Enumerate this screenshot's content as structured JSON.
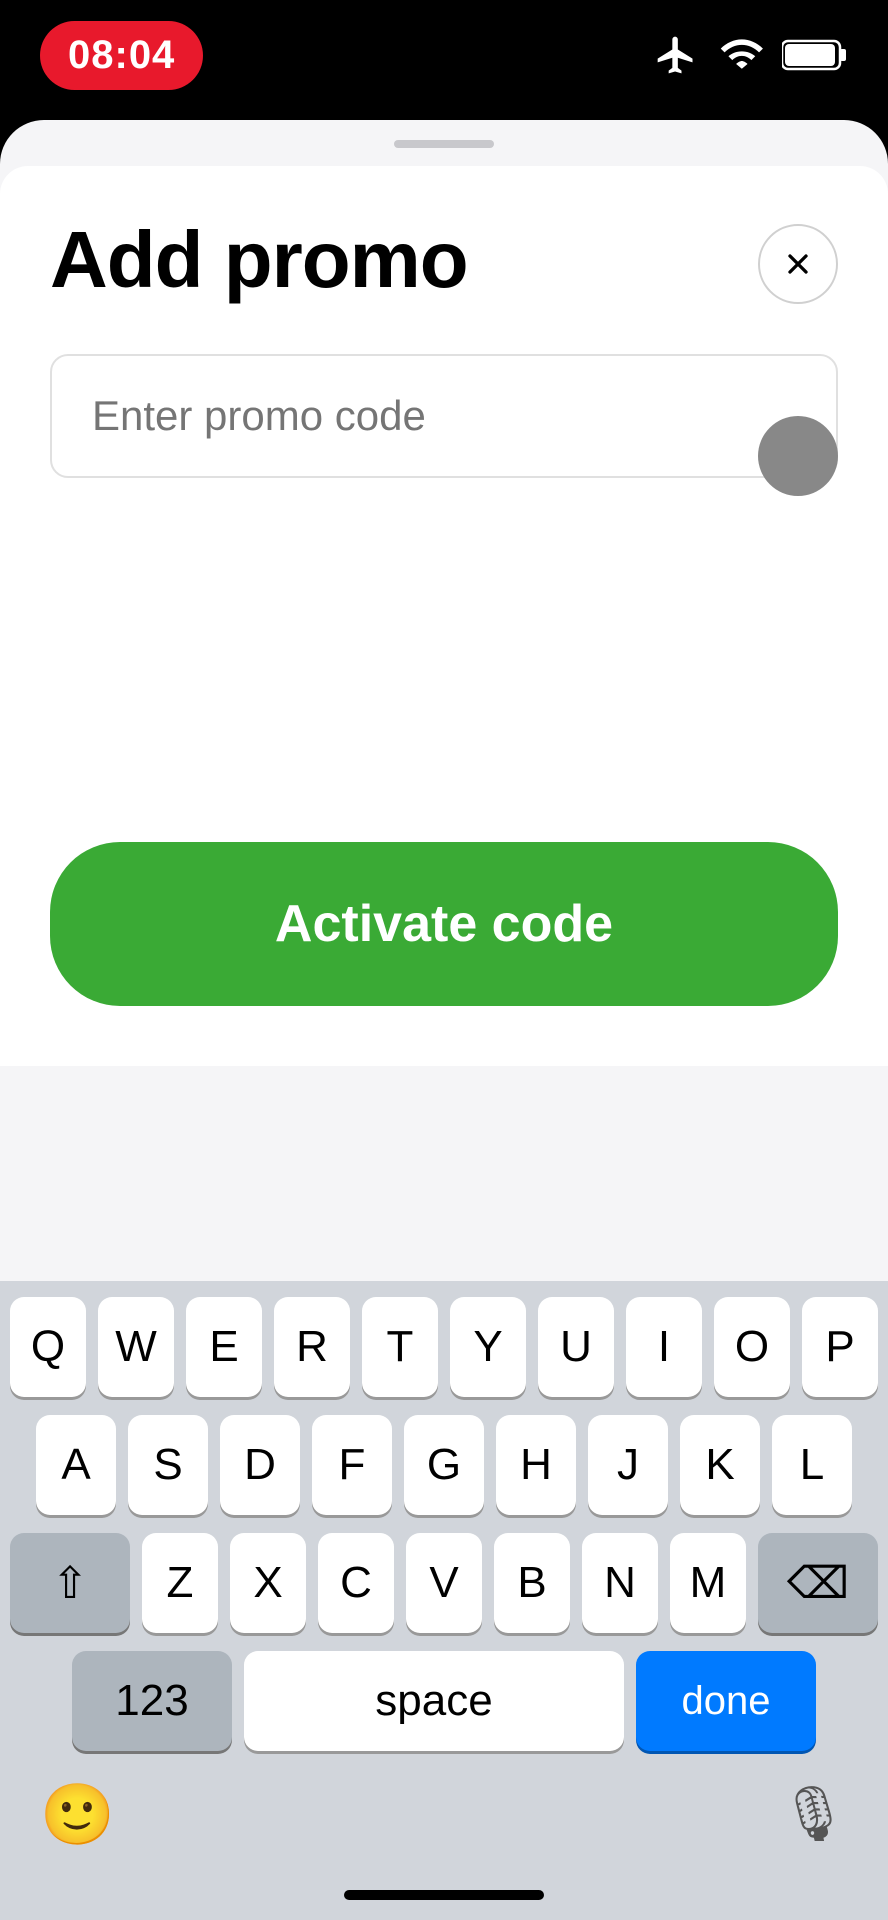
{
  "statusBar": {
    "time": "08:04"
  },
  "sheet": {
    "title": "Add promo",
    "closeLabel": "×",
    "promoInput": {
      "placeholder": "Enter promo code"
    },
    "activateButton": "Activate code"
  },
  "keyboard": {
    "rows": [
      [
        "Q",
        "W",
        "E",
        "R",
        "T",
        "Y",
        "U",
        "I",
        "O",
        "P"
      ],
      [
        "A",
        "S",
        "D",
        "F",
        "G",
        "H",
        "J",
        "K",
        "L"
      ],
      [
        "⇧",
        "Z",
        "X",
        "C",
        "V",
        "B",
        "N",
        "M",
        "⌫"
      ]
    ],
    "bottomRow": {
      "numbers": "123",
      "space": "space",
      "done": "done"
    }
  }
}
